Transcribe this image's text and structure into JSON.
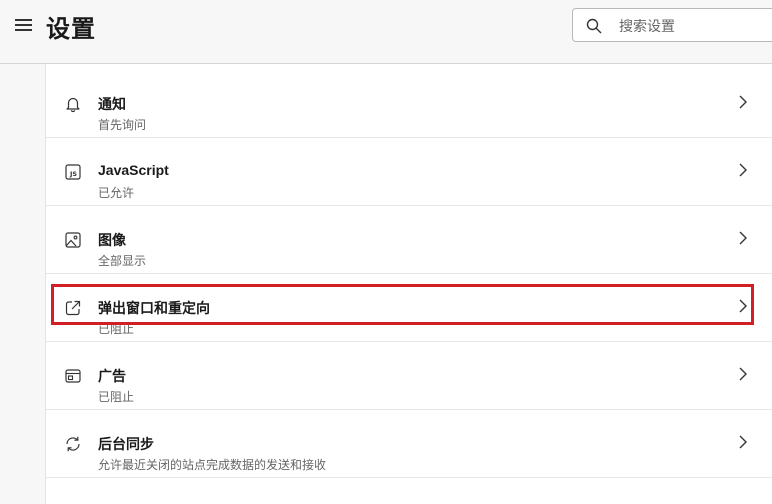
{
  "header": {
    "title": "设置",
    "search_placeholder": "搜索设置"
  },
  "items": [
    {
      "label": "通知",
      "sub": "首先询问",
      "icon": "bell-icon"
    },
    {
      "label": "JavaScript",
      "sub": "已允许",
      "icon": "js-icon"
    },
    {
      "label": "图像",
      "sub": "全部显示",
      "icon": "image-icon"
    },
    {
      "label": "弹出窗口和重定向",
      "sub": "已阻止",
      "icon": "popup-redirect-icon"
    },
    {
      "label": "广告",
      "sub": "已阻止",
      "icon": "ad-icon"
    },
    {
      "label": "后台同步",
      "sub": "允许最近关闭的站点完成数据的发送和接收",
      "icon": "sync-icon"
    }
  ],
  "colors": {
    "highlight": "#d21f25"
  }
}
